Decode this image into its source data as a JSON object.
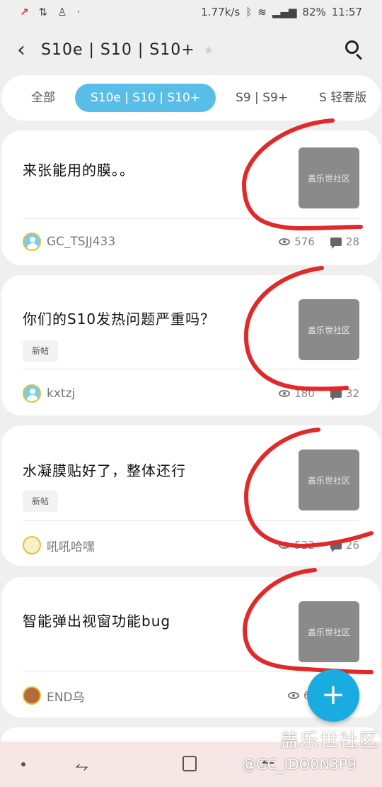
{
  "statusbar": {
    "left_icons": [
      "app-icon",
      "sync-icon",
      "person-icon",
      "dot"
    ],
    "speed": "1.77k/s",
    "battery": "82%",
    "time": "11:57"
  },
  "header": {
    "title": "S10e | S10 | S10+"
  },
  "tabs": [
    {
      "label": "全部"
    },
    {
      "label": "S10e | S10 | S10+"
    },
    {
      "label": "S9 | S9+"
    },
    {
      "label": "S 轻奢版"
    }
  ],
  "posts": [
    {
      "title": "来张能用的膜。。",
      "badge": "",
      "thumb": "盖乐世社区",
      "author": "GC_TSJJ433",
      "views": "576",
      "comments": "28"
    },
    {
      "title": "你们的S10发热问题严重吗？",
      "badge": "新帖",
      "thumb": "盖乐世社区",
      "author": "kxtzj",
      "views": "180",
      "comments": "32"
    },
    {
      "title": "水凝膜贴好了，整体还行",
      "badge": "新帖",
      "thumb": "盖乐世社区",
      "author": "吼吼哈嘿",
      "views": "522",
      "comments": "26"
    },
    {
      "title": "智能弹出视窗功能bug",
      "badge": "",
      "thumb": "盖乐世社区",
      "author": "END乌",
      "views": "62",
      "comments": ""
    }
  ],
  "fab": {
    "label": "+"
  },
  "watermark": {
    "line1": "盖乐世社区",
    "line2": "@GC_IDO0N3P9"
  },
  "colors": {
    "accent": "#58bee8",
    "fab": "#1aace0",
    "annotation": "#e02a2a"
  }
}
